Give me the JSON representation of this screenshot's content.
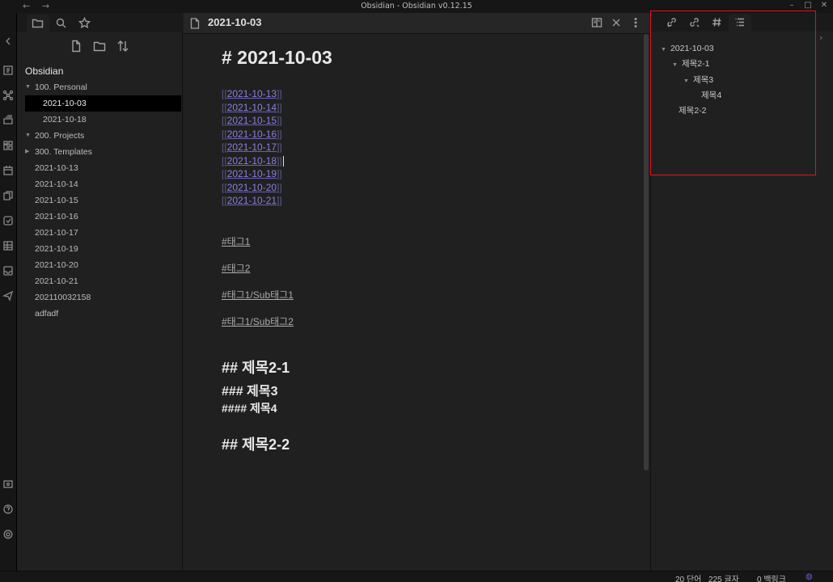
{
  "window": {
    "title": "Obsidian - Obsidian v0.12.15",
    "back": "←",
    "forward": "→",
    "minimize": "–",
    "maximize": "□",
    "close": "✕"
  },
  "ribbon": {
    "icons": [
      "sidebar-expand-icon",
      "open-quick-switcher-icon",
      "graph-view-icon",
      "open-kanban-icon",
      "calendar-grid-icon",
      "daily-note-icon",
      "templates-icon",
      "checklist-icon",
      "table-icon",
      "inbox-icon",
      "send-icon",
      "vault-switch-icon",
      "help-icon",
      "settings-icon"
    ]
  },
  "explorer": {
    "tabs": [
      "file-explorer",
      "search",
      "starred"
    ],
    "vault_name": "Obsidian",
    "items": [
      {
        "label": "100. Personal",
        "type": "folder",
        "expanded": true
      },
      {
        "label": "2021-10-03",
        "type": "file",
        "indent": 1,
        "selected": true
      },
      {
        "label": "2021-10-18",
        "type": "file",
        "indent": 1
      },
      {
        "label": "200. Projects",
        "type": "folder",
        "expanded": true
      },
      {
        "label": "300. Templates",
        "type": "folder",
        "expanded": false
      },
      {
        "label": "2021-10-13",
        "type": "file"
      },
      {
        "label": "2021-10-14",
        "type": "file"
      },
      {
        "label": "2021-10-15",
        "type": "file"
      },
      {
        "label": "2021-10-16",
        "type": "file"
      },
      {
        "label": "2021-10-17",
        "type": "file"
      },
      {
        "label": "2021-10-19",
        "type": "file"
      },
      {
        "label": "2021-10-20",
        "type": "file"
      },
      {
        "label": "2021-10-21",
        "type": "file"
      },
      {
        "label": "202110032158",
        "type": "file"
      },
      {
        "label": "adfadf",
        "type": "file"
      }
    ]
  },
  "editor": {
    "tab_title": "2021-10-03",
    "h1": "# 2021-10-03",
    "links": [
      "2021-10-13",
      "2021-10-14",
      "2021-10-15",
      "2021-10-16",
      "2021-10-17",
      "2021-10-18",
      "2021-10-19",
      "2021-10-20",
      "2021-10-21"
    ],
    "link_open": "[[",
    "link_close": "]]",
    "tags": [
      "#태그1",
      "#태그2",
      "#태그1/Sub태그1",
      "#태그1/Sub태그2"
    ],
    "headings": [
      {
        "level": "h2",
        "text": "## 제목2-1"
      },
      {
        "level": "h3",
        "text": "### 제목3"
      },
      {
        "level": "h4",
        "text": "#### 제목4"
      },
      {
        "level": "h2",
        "text": "## 제목2-2"
      }
    ]
  },
  "outline": {
    "tabs": [
      "backlinks",
      "outgoing-links",
      "tags",
      "outline"
    ],
    "items": [
      {
        "label": "2021-10-03",
        "expanded": true
      },
      {
        "label": "제목2-1",
        "expanded": true
      },
      {
        "label": "제목3",
        "expanded": true
      },
      {
        "label": "제목4"
      },
      {
        "label": "제목2-2"
      }
    ]
  },
  "status": {
    "words": "20 단어",
    "chars": "225 글자",
    "backlinks": "0 백링크"
  },
  "colors": {
    "link": "#8b7fe0",
    "highlight_box": "#e0141c",
    "selected_bg": "#000000"
  }
}
